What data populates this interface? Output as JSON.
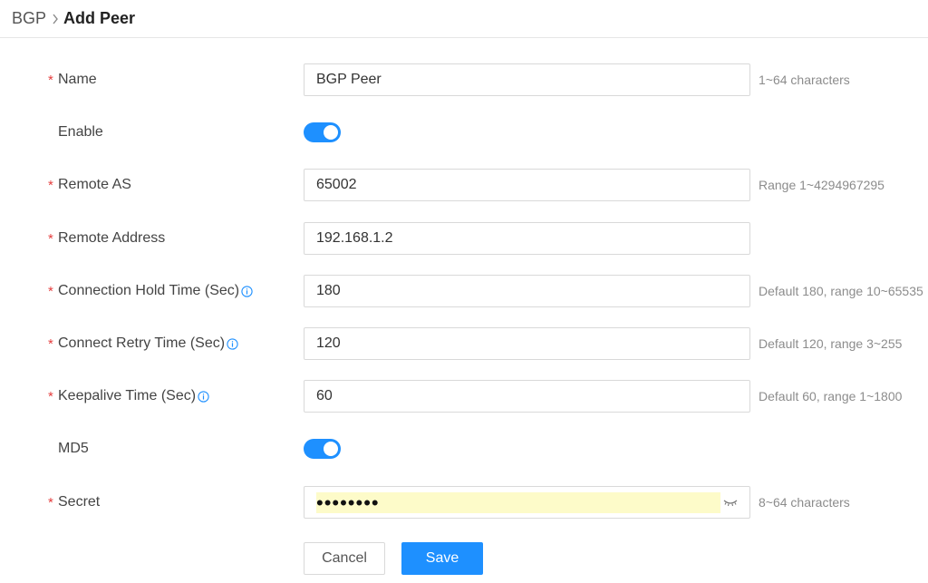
{
  "breadcrumb": {
    "parent": "BGP",
    "current": "Add Peer"
  },
  "form": {
    "name": {
      "label": "Name",
      "value": "BGP Peer",
      "hint": "1~64 characters"
    },
    "enable": {
      "label": "Enable",
      "on": true
    },
    "remote_as": {
      "label": "Remote AS",
      "value": "65002",
      "hint": "Range 1~4294967295"
    },
    "remote_address": {
      "label": "Remote Address",
      "value": "192.168.1.2"
    },
    "hold_time": {
      "label": "Connection Hold Time (Sec)",
      "value": "180",
      "hint": "Default 180, range 10~65535"
    },
    "retry_time": {
      "label": "Connect Retry Time (Sec)",
      "value": "120",
      "hint": "Default 120, range 3~255"
    },
    "keepalive_time": {
      "label": "Keepalive Time (Sec)",
      "value": "60",
      "hint": "Default 60, range 1~1800"
    },
    "md5": {
      "label": "MD5",
      "on": true
    },
    "secret": {
      "label": "Secret",
      "masked": "••••••••",
      "hint": "8~64 characters"
    }
  },
  "required_mark": "*",
  "buttons": {
    "cancel": "Cancel",
    "save": "Save"
  },
  "colors": {
    "accent": "#1e90ff",
    "required": "#e53e3e",
    "autofill": "#fdfbc9"
  }
}
